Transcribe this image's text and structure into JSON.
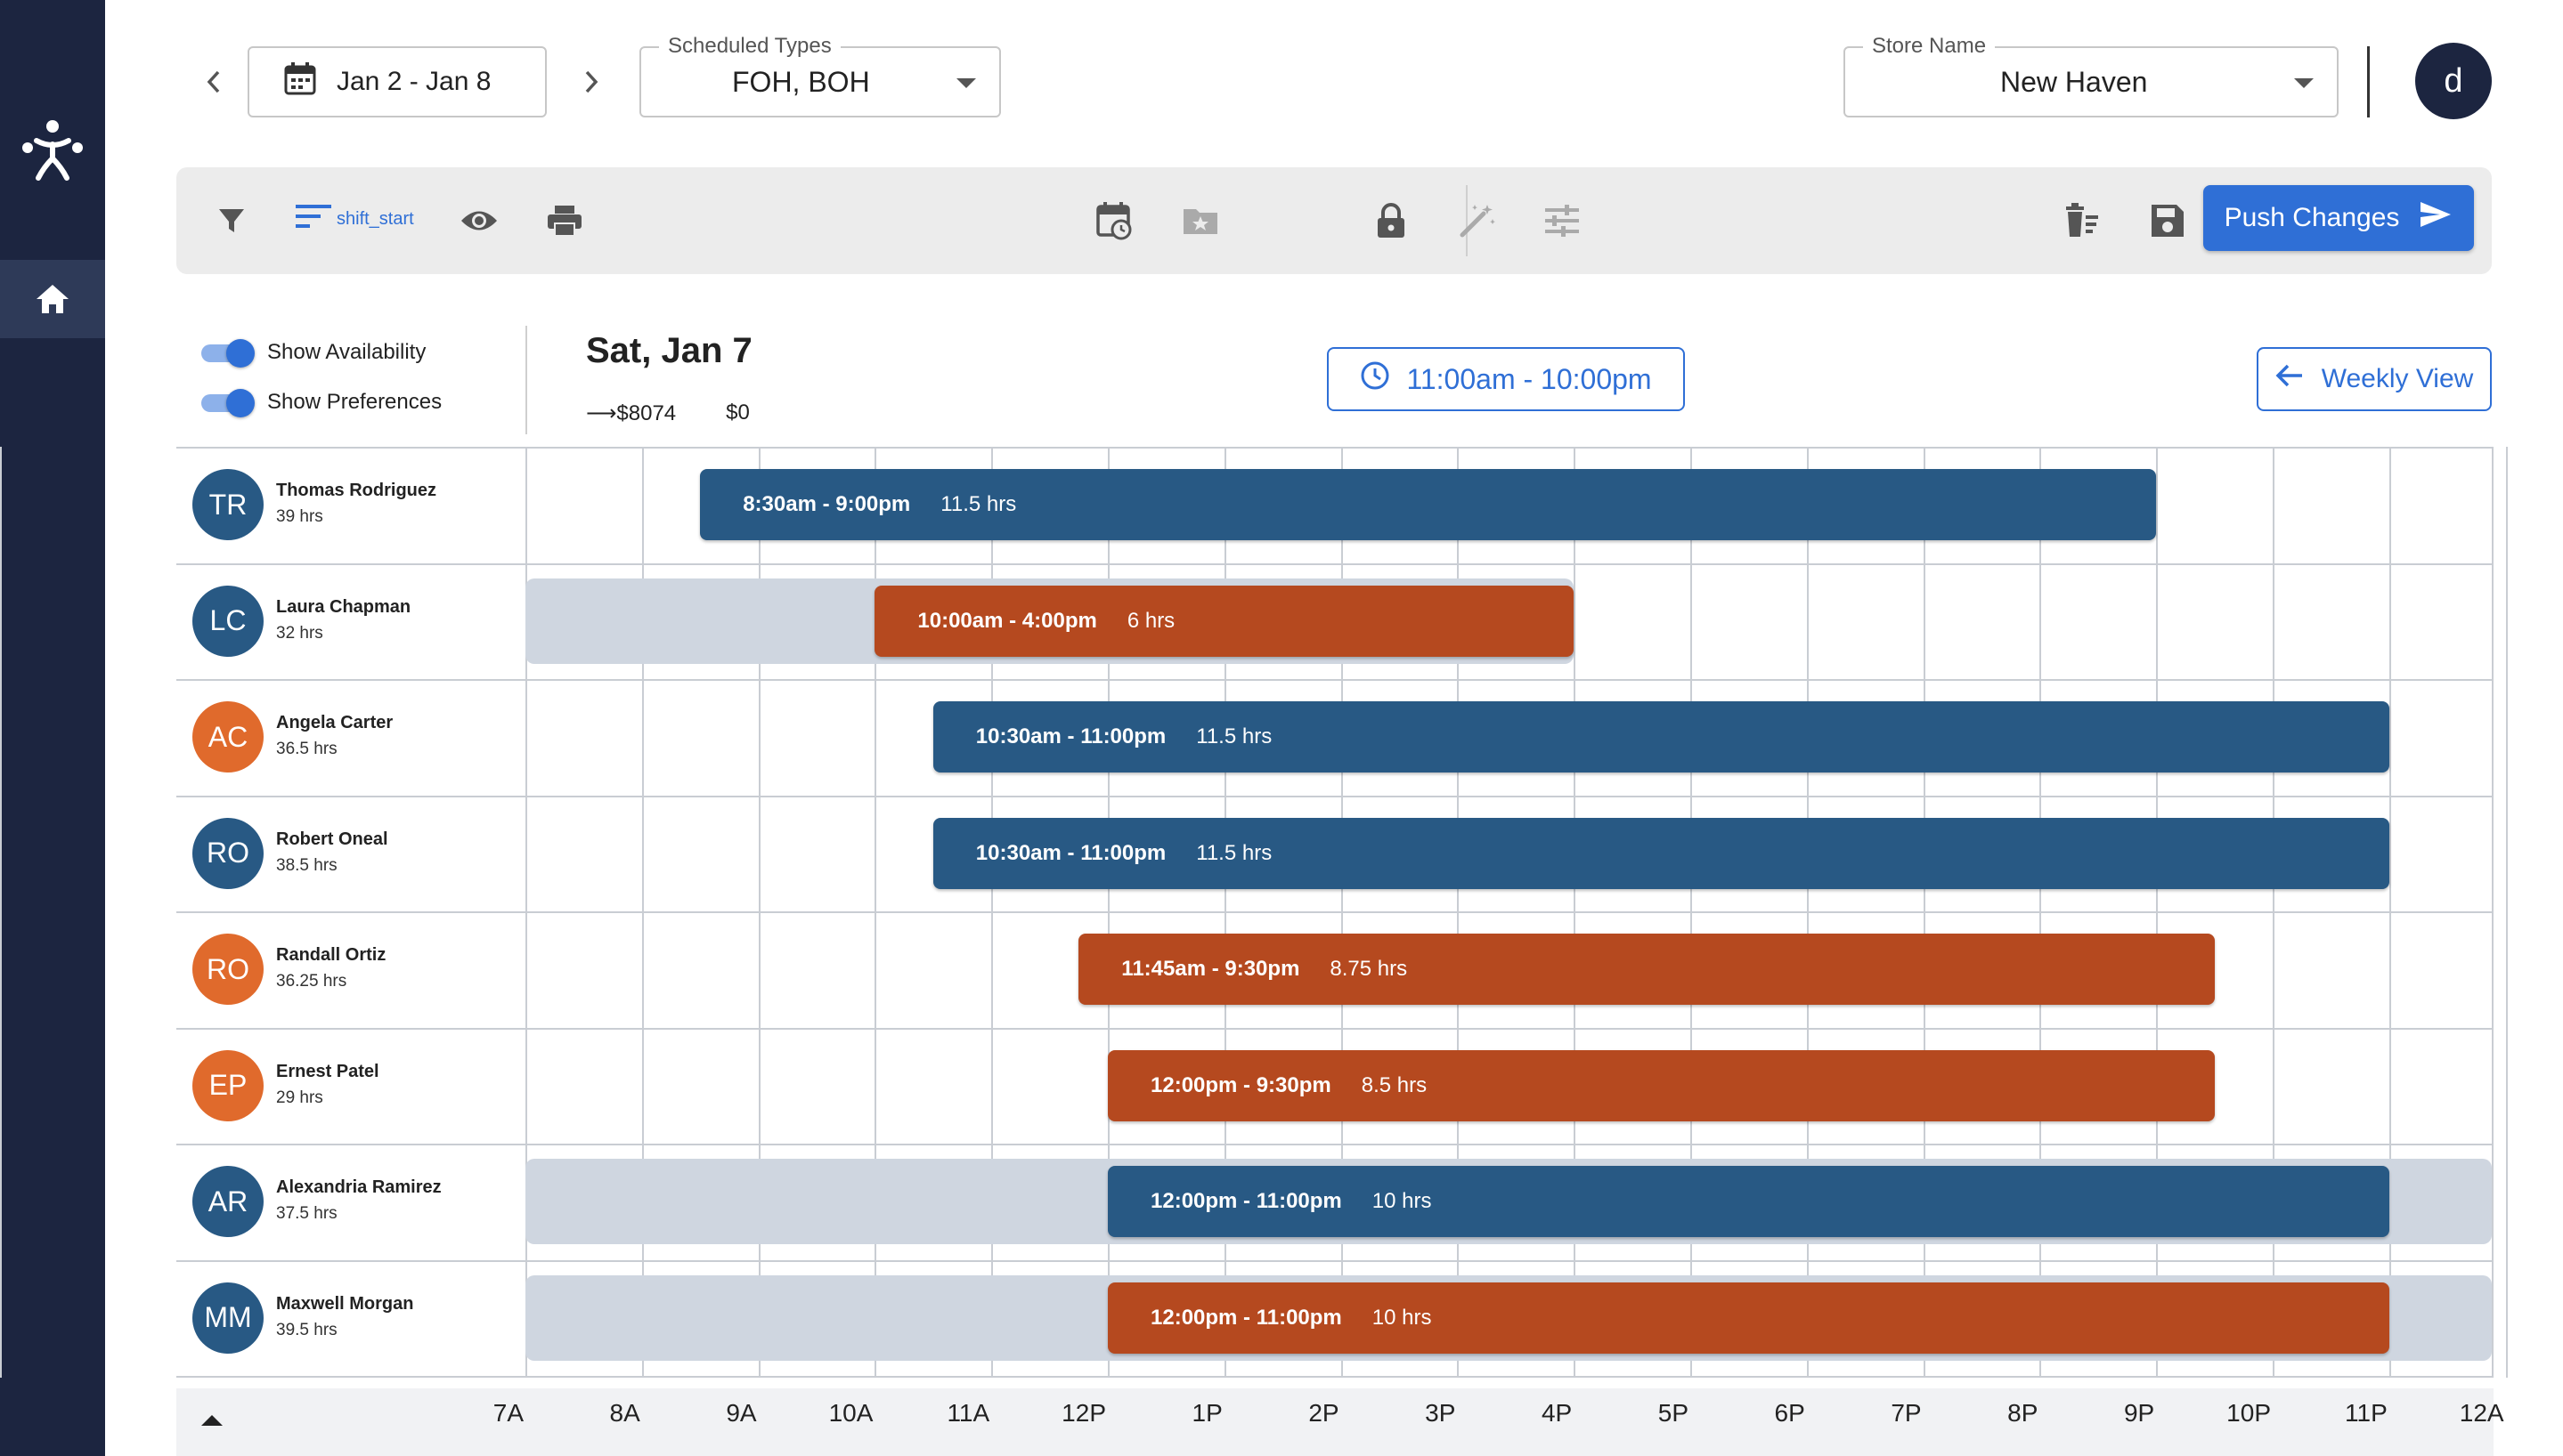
{
  "topbar": {
    "date_range": "Jan 2 - Jan 8",
    "scheduled_types_label": "Scheduled Types",
    "scheduled_types_value": "FOH, BOH",
    "store_label": "Store Name",
    "store_value": "New Haven",
    "user_initial": "d"
  },
  "toolbar": {
    "sort_label": "shift_start",
    "push_label": "Push Changes"
  },
  "toggles": {
    "availability_label": "Show Availability",
    "preferences_label": "Show Preferences"
  },
  "day": {
    "title": "Sat, Jan 7",
    "cost": "$8074",
    "other_cost": "$0",
    "hours_chip": "11:00am - 10:00pm",
    "weekly_view_label": "Weekly View"
  },
  "colors": {
    "blue_shift": "#285984",
    "orange_shift": "#b5491f",
    "availability": "#cfd6e0",
    "accent": "#2f6fd6",
    "rail": "#1c2540"
  },
  "employees": [
    {
      "initials": "TR",
      "name": "Thomas Rodriguez",
      "hours": "39 hrs",
      "avatar_color": "#285984",
      "shift": {
        "time": "8:30am - 9:00pm",
        "duration": "11.5 hrs",
        "color": "blue",
        "start": 8.5,
        "end": 21.0
      }
    },
    {
      "initials": "LC",
      "name": "Laura Chapman",
      "hours": "32 hrs",
      "avatar_color": "#285984",
      "availability": {
        "start": 7.0,
        "end": 16.0
      },
      "shift": {
        "time": "10:00am - 4:00pm",
        "duration": "6 hrs",
        "color": "orange",
        "start": 10.0,
        "end": 16.0
      }
    },
    {
      "initials": "AC",
      "name": "Angela Carter",
      "hours": "36.5 hrs",
      "avatar_color": "#e06a2c",
      "shift": {
        "time": "10:30am - 11:00pm",
        "duration": "11.5 hrs",
        "color": "blue",
        "start": 10.5,
        "end": 23.0
      }
    },
    {
      "initials": "RO",
      "name": "Robert Oneal",
      "hours": "38.5 hrs",
      "avatar_color": "#285984",
      "shift": {
        "time": "10:30am - 11:00pm",
        "duration": "11.5 hrs",
        "color": "blue",
        "start": 10.5,
        "end": 23.0
      }
    },
    {
      "initials": "RO",
      "name": "Randall Ortiz",
      "hours": "36.25 hrs",
      "avatar_color": "#e06a2c",
      "shift": {
        "time": "11:45am - 9:30pm",
        "duration": "8.75 hrs",
        "color": "orange",
        "start": 11.75,
        "end": 21.5
      }
    },
    {
      "initials": "EP",
      "name": "Ernest Patel",
      "hours": "29 hrs",
      "avatar_color": "#e06a2c",
      "shift": {
        "time": "12:00pm - 9:30pm",
        "duration": "8.5 hrs",
        "color": "orange",
        "start": 12.0,
        "end": 21.5
      }
    },
    {
      "initials": "AR",
      "name": "Alexandria Ramirez",
      "hours": "37.5 hrs",
      "avatar_color": "#285984",
      "availability": {
        "start": 7.0,
        "end": 24.0
      },
      "shift": {
        "time": "12:00pm - 11:00pm",
        "duration": "10 hrs",
        "color": "blue",
        "start": 12.0,
        "end": 23.0
      }
    },
    {
      "initials": "MM",
      "name": "Maxwell Morgan",
      "hours": "39.5 hrs",
      "avatar_color": "#285984",
      "availability": {
        "start": 7.0,
        "end": 24.0
      },
      "shift": {
        "time": "12:00pm - 11:00pm",
        "duration": "10 hrs",
        "color": "orange",
        "start": 12.0,
        "end": 23.0
      }
    }
  ],
  "time_axis": [
    "7A",
    "8A",
    "9A",
    "10A",
    "11A",
    "12P",
    "1P",
    "2P",
    "3P",
    "4P",
    "5P",
    "6P",
    "7P",
    "8P",
    "9P",
    "10P",
    "11P",
    "12A"
  ]
}
